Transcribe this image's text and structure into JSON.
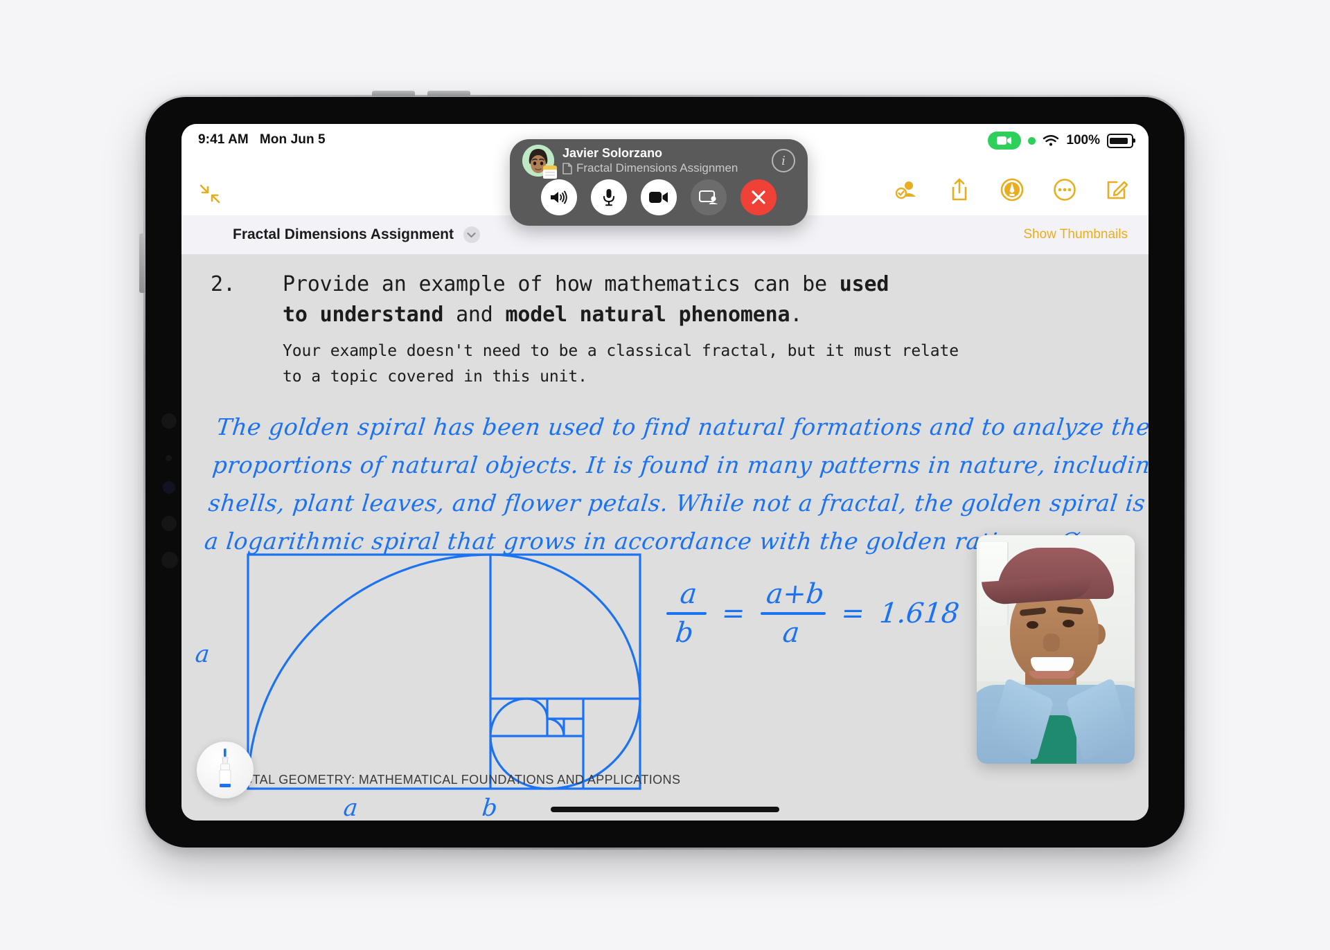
{
  "statusbar": {
    "time": "9:41 AM",
    "date": "Mon Jun 5",
    "battery_percent": "100%",
    "camera_icon": "camera-active-pill",
    "recording_dot": "green-recording-dot",
    "wifi_icon": "wifi-icon",
    "battery_icon": "battery-full-icon"
  },
  "toolbar": {
    "collapse_icon": "collapse-arrows-icon",
    "icons": [
      {
        "name": "collaboration-icon",
        "label": "Collaborate"
      },
      {
        "name": "share-icon",
        "label": "Share"
      },
      {
        "name": "markup-pencil-icon",
        "label": "Markup"
      },
      {
        "name": "more-options-icon",
        "label": "More"
      },
      {
        "name": "compose-icon",
        "label": "Compose"
      }
    ],
    "accent_color": "#e8ae20"
  },
  "titlebar": {
    "document_title": "Fractal Dimensions Assignment",
    "chevron_icon": "chevron-down-icon",
    "show_thumbnails_label": "Show Thumbnails"
  },
  "document": {
    "question_number": "2.",
    "lead_parts": [
      {
        "text": "Provide an example of how mathematics can be ",
        "bold": false
      },
      {
        "text": "used to understand",
        "bold": true
      },
      {
        "text": " and ",
        "bold": false
      },
      {
        "text": "model natural phenomena",
        "bold": true
      },
      {
        "text": ".",
        "bold": false
      }
    ],
    "lead_line_1_plain": "Provide an example of how mathematics can be ",
    "lead_line_1_bold": "used",
    "lead_line_2_bold_a": "to understand",
    "lead_line_2_plain": " and ",
    "lead_line_2_bold_b": "model natural phenomena",
    "lead_line_2_end": ".",
    "sub_line_1": "Your example doesn't need to be a classical fractal, but it must relate",
    "sub_line_2": "to a topic covered in this unit.",
    "handwriting_lines": [
      "The golden spiral has been used to find natural formations and to analyze the",
      "proportions of natural objects. It is found in many patterns in nature, including",
      "shells, plant leaves, and flower petals. While not a fractal, the golden spiral is",
      "a logarithmic spiral that grows in accordance with the golden ratio, or Ø."
    ],
    "diagram": {
      "name": "golden-spiral-diagram",
      "label_height": "a",
      "label_width_a": "a",
      "label_width_b": "b",
      "ink_color": "#1b72f2"
    },
    "equation": {
      "numerator_1": "a",
      "denominator_1": "b",
      "equals_1": "=",
      "numerator_2": "a+b",
      "denominator_2": "a",
      "equals_2": "=",
      "result": "1.618"
    },
    "footer": "FRACTAL GEOMETRY: MATHEMATICAL FOUNDATIONS AND APPLICATIONS"
  },
  "pen_tool": {
    "name": "pen-tool-button",
    "ink_color": "#1b72f2"
  },
  "facetime": {
    "participant_name": "Javier Solorzano",
    "shared_document": "Fractal Dimensions Assignmen",
    "document_icon": "document-icon",
    "info_icon": "i",
    "avatar_name": "memoji-avatar",
    "controls": [
      {
        "name": "speaker-button",
        "icon": "speaker-icon",
        "style": "light"
      },
      {
        "name": "mute-button",
        "icon": "microphone-icon",
        "style": "light"
      },
      {
        "name": "video-button",
        "icon": "video-camera-icon",
        "style": "light"
      },
      {
        "name": "share-screen-button",
        "icon": "share-screen-icon",
        "style": "dim"
      },
      {
        "name": "end-call-button",
        "icon": "close-x-icon",
        "style": "end"
      }
    ],
    "end_call_color": "#ef4136"
  },
  "video_pip": {
    "name": "participant-video",
    "description": "Smiling person wearing a maroon cap and denim jacket over a green shirt"
  }
}
